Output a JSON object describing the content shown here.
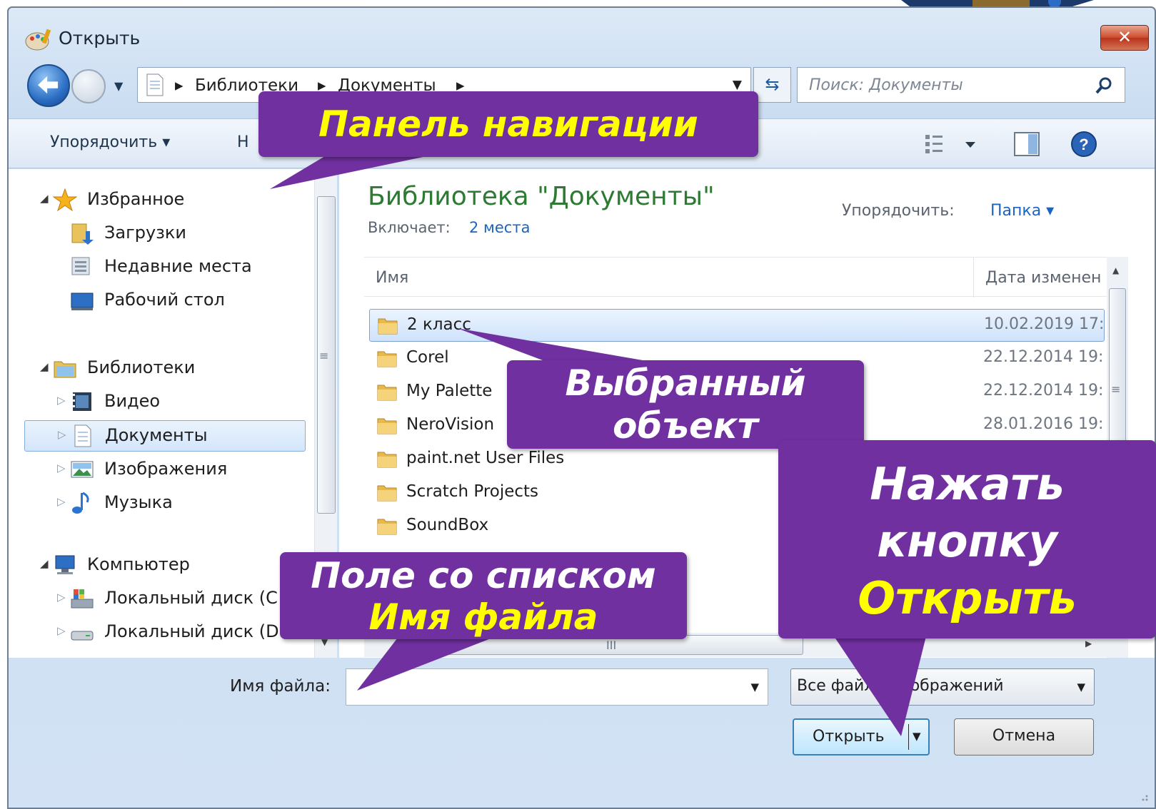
{
  "window": {
    "title": "Открыть",
    "close_label": "✕"
  },
  "address": {
    "crumbs": [
      "Библиотеки",
      "Документы"
    ],
    "separator": "▸"
  },
  "search": {
    "placeholder": "Поиск: Документы"
  },
  "toolbar": {
    "organize_label": "Упорядочить ▾",
    "new_folder_label": "Н"
  },
  "nav": {
    "items": [
      {
        "label": "Избранное",
        "icon": "star-icon"
      },
      {
        "label": "Загрузки",
        "icon": "downloads-icon"
      },
      {
        "label": "Недавние места",
        "icon": "recent-places-icon"
      },
      {
        "label": "Рабочий стол",
        "icon": "desktop-icon"
      },
      {
        "label": "Библиотеки",
        "icon": "libraries-icon"
      },
      {
        "label": "Видео",
        "icon": "video-icon"
      },
      {
        "label": "Документы",
        "icon": "documents-icon",
        "selected": true
      },
      {
        "label": "Изображения",
        "icon": "pictures-icon"
      },
      {
        "label": "Музыка",
        "icon": "music-icon"
      },
      {
        "label": "Компьютер",
        "icon": "computer-icon"
      },
      {
        "label": "Локальный диск (C",
        "icon": "drive-c-icon"
      },
      {
        "label": "Локальный диск (D:)",
        "icon": "drive-d-icon"
      }
    ]
  },
  "library": {
    "title": "Библиотека \"Документы\"",
    "includes_label": "Включает:",
    "includes_value": "2 места",
    "arrange_label": "Упорядочить:",
    "arrange_value": "Папка ▾"
  },
  "columns": {
    "name": "Имя",
    "date": "Дата изменен"
  },
  "files": [
    {
      "name": "2 класс",
      "date": "10.02.2019 17:",
      "selected": true
    },
    {
      "name": "Corel",
      "date": "22.12.2014 19:"
    },
    {
      "name": "My Palette",
      "date": "22.12.2014 19:"
    },
    {
      "name": "NeroVision",
      "date": "28.01.2016 19:"
    },
    {
      "name": "paint.net User Files",
      "date": ""
    },
    {
      "name": "Scratch Projects",
      "date": ""
    },
    {
      "name": "SoundBox",
      "date": ""
    }
  ],
  "bottom": {
    "filename_label": "Имя файла:",
    "filename_value": "",
    "filetype_value": "Все файлы изображений",
    "open_label": "Открыть",
    "cancel_label": "Отмена"
  },
  "callouts": {
    "nav_panel": "Панель навигации",
    "selected_line1": "Выбранный",
    "selected_line2": "объект",
    "filename_line1": "Поле со списком",
    "filename_line2": "Имя файла",
    "press_line1": "Нажать",
    "press_line2": "кнопку",
    "press_line3": "Открыть"
  },
  "colors": {
    "callout": "#7030a0",
    "callout_highlight": "#ffff00",
    "library_title": "#2d7a33",
    "link": "#1a64c4"
  }
}
